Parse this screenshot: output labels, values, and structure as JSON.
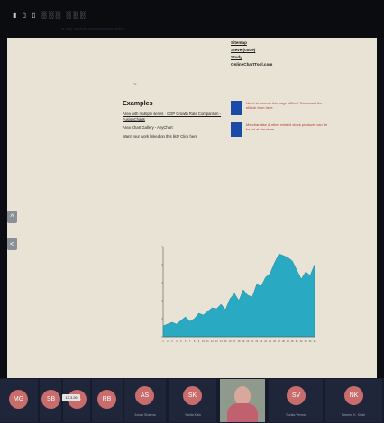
{
  "browser": {
    "tab_glyphs": "▮ ▯ ▯ ░░░ ░░░",
    "address": "~ ~~ ~~~~ ~~~~~~~~ ~~~"
  },
  "page": {
    "nav_links": [
      "Sitemap",
      "Steve (code)",
      "Study",
      "OnlineChartTool.com"
    ],
    "dash": "~",
    "examples": {
      "heading": "Examples",
      "links": [
        "Area with multiple series · GDP Growth Rate Comparison - FusionCharts",
        "Area Chart Gallery - AnyChart",
        "Want your work linked on this list? Click here"
      ]
    },
    "promo": [
      {
        "text": "Need to access this page offline? Download the eBook from here"
      },
      {
        "text": "Merchandise & other related stock products can be found at the store"
      }
    ],
    "side_buttons": [
      "^",
      "<"
    ],
    "home_icon": "home-icon"
  },
  "chart_data": {
    "type": "area",
    "categories": [
      "1",
      "2",
      "3",
      "4",
      "5",
      "6",
      "7",
      "8",
      "9",
      "10",
      "11",
      "12",
      "13",
      "14",
      "15",
      "16",
      "17",
      "18",
      "19",
      "20",
      "21",
      "22",
      "23",
      "24",
      "25",
      "26",
      "27",
      "28",
      "29",
      "30",
      "31",
      "32",
      "33",
      "34",
      "35"
    ],
    "values": [
      12,
      14,
      16,
      14,
      18,
      22,
      17,
      20,
      26,
      24,
      28,
      32,
      31,
      36,
      30,
      42,
      48,
      40,
      52,
      46,
      44,
      58,
      56,
      66,
      70,
      82,
      92,
      90,
      88,
      84,
      74,
      64,
      72,
      68,
      80
    ],
    "ylim": [
      0,
      100
    ],
    "ytick_labels": [
      "",
      "",
      "",
      "",
      "",
      ""
    ],
    "colors": {
      "fill": "#2aa9c2",
      "stroke": "#1f8aa0",
      "axis": "#555555",
      "text": "#555555"
    }
  },
  "participants": [
    {
      "initials": "MG",
      "name": "",
      "color": "#c86c6c"
    },
    {
      "initials": "SB",
      "name": "",
      "color": "#c86c6c"
    },
    {
      "initials": "LB",
      "name": "",
      "color": "#c86c6c"
    },
    {
      "initials": "RB",
      "name": "",
      "color": "#c86c6c"
    },
    {
      "initials": "AS",
      "name": "Arnab Sharma",
      "color": "#c86c6c"
    },
    {
      "initials": "SK",
      "name": "Sarita Kalo",
      "color": "#c86c6c"
    },
    {
      "initials": "SV",
      "name": "Sunita Verma",
      "color": "#c86c6c"
    },
    {
      "initials": "NK",
      "name": "Naveen K. Shah",
      "color": "#c86c6c"
    }
  ],
  "tag_label": "13.3.26"
}
